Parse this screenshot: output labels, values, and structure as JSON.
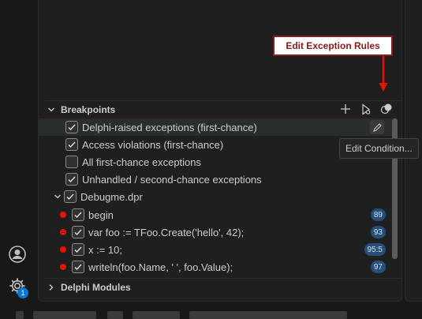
{
  "callout": {
    "label": "Edit Exception Rules"
  },
  "tooltip": {
    "label": "Edit Condition..."
  },
  "breakpoints": {
    "title": "Breakpoints",
    "exceptions": [
      {
        "label": "Delphi-raised exceptions (first-chance)",
        "checked": true
      },
      {
        "label": "Access violations (first-chance)",
        "checked": true
      },
      {
        "label": "All first-chance exceptions",
        "checked": false
      },
      {
        "label": "Unhandled / second-chance exceptions",
        "checked": true
      }
    ],
    "file": {
      "name": "Debugme.dpr",
      "checked": true
    },
    "lines": [
      {
        "code": "begin",
        "badge": "89",
        "marker": "breakpoint"
      },
      {
        "code": "var foo := TFoo.Create('hello', 42);",
        "badge": "93",
        "marker": "conditional"
      },
      {
        "code": "x := 10;",
        "badge": "95:5",
        "marker": "breakpoint"
      },
      {
        "code": "writeln(foo.Name, ' ', foo.Value);",
        "badge": "97",
        "marker": "breakpoint"
      }
    ]
  },
  "modules": {
    "title": "Delphi Modules"
  },
  "activity": {
    "notification_count": "1"
  },
  "colors": {
    "breakpoint": "#e51400",
    "badge": "#264f78",
    "callout_border": "#8b1a1a",
    "arrow": "#e51400"
  }
}
